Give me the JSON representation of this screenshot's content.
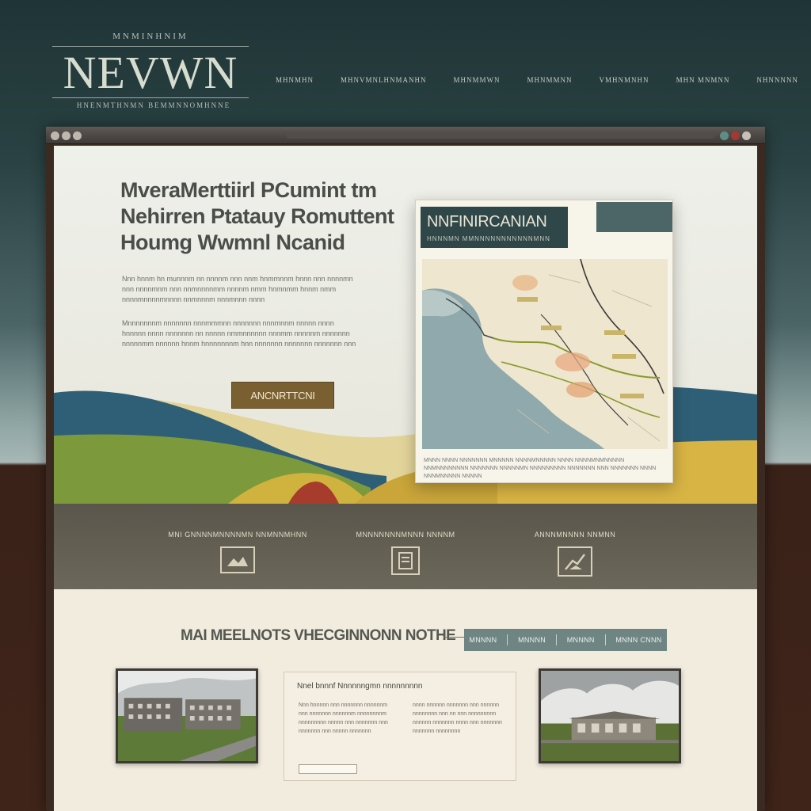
{
  "header": {
    "brand_top": "MNMINHNIM",
    "brand_name": "NEVWN",
    "brand_sub": "HNENMTHNMN BEMMNNOMHNNE",
    "nav": [
      "MHNMHN",
      "MHNVMNLHNMANHN",
      "MHNMMWN",
      "MHNMMNN",
      "VMHNMNHN",
      "MHN MNMNN",
      "NHNNNNN"
    ]
  },
  "hero": {
    "title_line1": "MveraMerttiirl PCumint tm",
    "title_line2": "Nehirren Ptatauy Romuttent",
    "title_line3": "Houmg Wwmnl Ncanid",
    "paragraph1": "Nnn hnnm hn munnnm nn nnnnm nnn nnm hnmmnnm hnnn nnn nnnnmn nnn nnnnmnm nnn nnmnnnnmm nnnnm nmm hnmnmm hnnm nmm nnnnmnnnnmnnnn nnmnnnm nnnmnnn nnnn",
    "paragraph2": "Mnnnnnnnm nnnnnnn nnnmmmnn nnnnnnn nnnmnnm nnnnn nnnn hnnnnn nnnn nnnnnnn nn nnnnn nmmnnnnnn nnnmm nnnnnm nnnnnnn nnnnnmm nnnnnn hnnm hnnnnnnnm hnn nnnnnnn nnnnnnn nnnnnnn nnn",
    "button": "ANCNRTTCNI"
  },
  "map_card": {
    "title": "NNFINIRCANIAN",
    "subtitle": "HNNNMN MMNNNNNNNNNNNMNN",
    "caption": "MNNN NNNN NNNNNNN MNNNNN NNNNMNNNNN NNNN NNNNMNMNNNNN NNMNNNNNNNN NNNNNNN NNNNNMN NNNNNNNNN NNNNNNN NNN NNNNNNN NNNN NNNMNNNNN NNNNN"
  },
  "features": [
    {
      "label": "MNI GNNNNMNNNNMN NNMNNMHNN",
      "icon": "image-icon"
    },
    {
      "label": "MNNNNNNNMNNN NNNNM",
      "icon": "document-icon"
    },
    {
      "label": "ANNNMNNNN NNMNN",
      "icon": "chart-icon"
    }
  ],
  "listing": {
    "title": "MAI MEELNOTS VHECGINNONN NOTHE",
    "filters": [
      "MNNNN",
      "MNNNN",
      "MNNNN",
      "MNNN CNNN"
    ],
    "info_title": "Nnel bnnnf Nnnnnngmn nnnnnnnnn",
    "info_col1": "Nnn hnnnnn nnn nnnnnnn nnnnnnm nnn nnnnnnn nnnnnnm nnnnnnnnm nnnnnnnnn nnnnn nnn nnnnnnn nnn nnnnnnn nnn nnnnn nnnnnnn",
    "info_col2": "nnnn nnnnnn nnnnnnn nnn nnnnnn nnnnnnnn nnn nn nnn nnnnnnnnn nnnnnn nnnnnnn nnnn nnn nnnnnnn nnnnnnn nnnnnnnn"
  },
  "colors": {
    "header_bg": "#243a3b",
    "hero_btn": "#7a6030",
    "map_label": "#2f4748",
    "filter_bar": "#6e8583",
    "features_band": "#5a564b"
  }
}
